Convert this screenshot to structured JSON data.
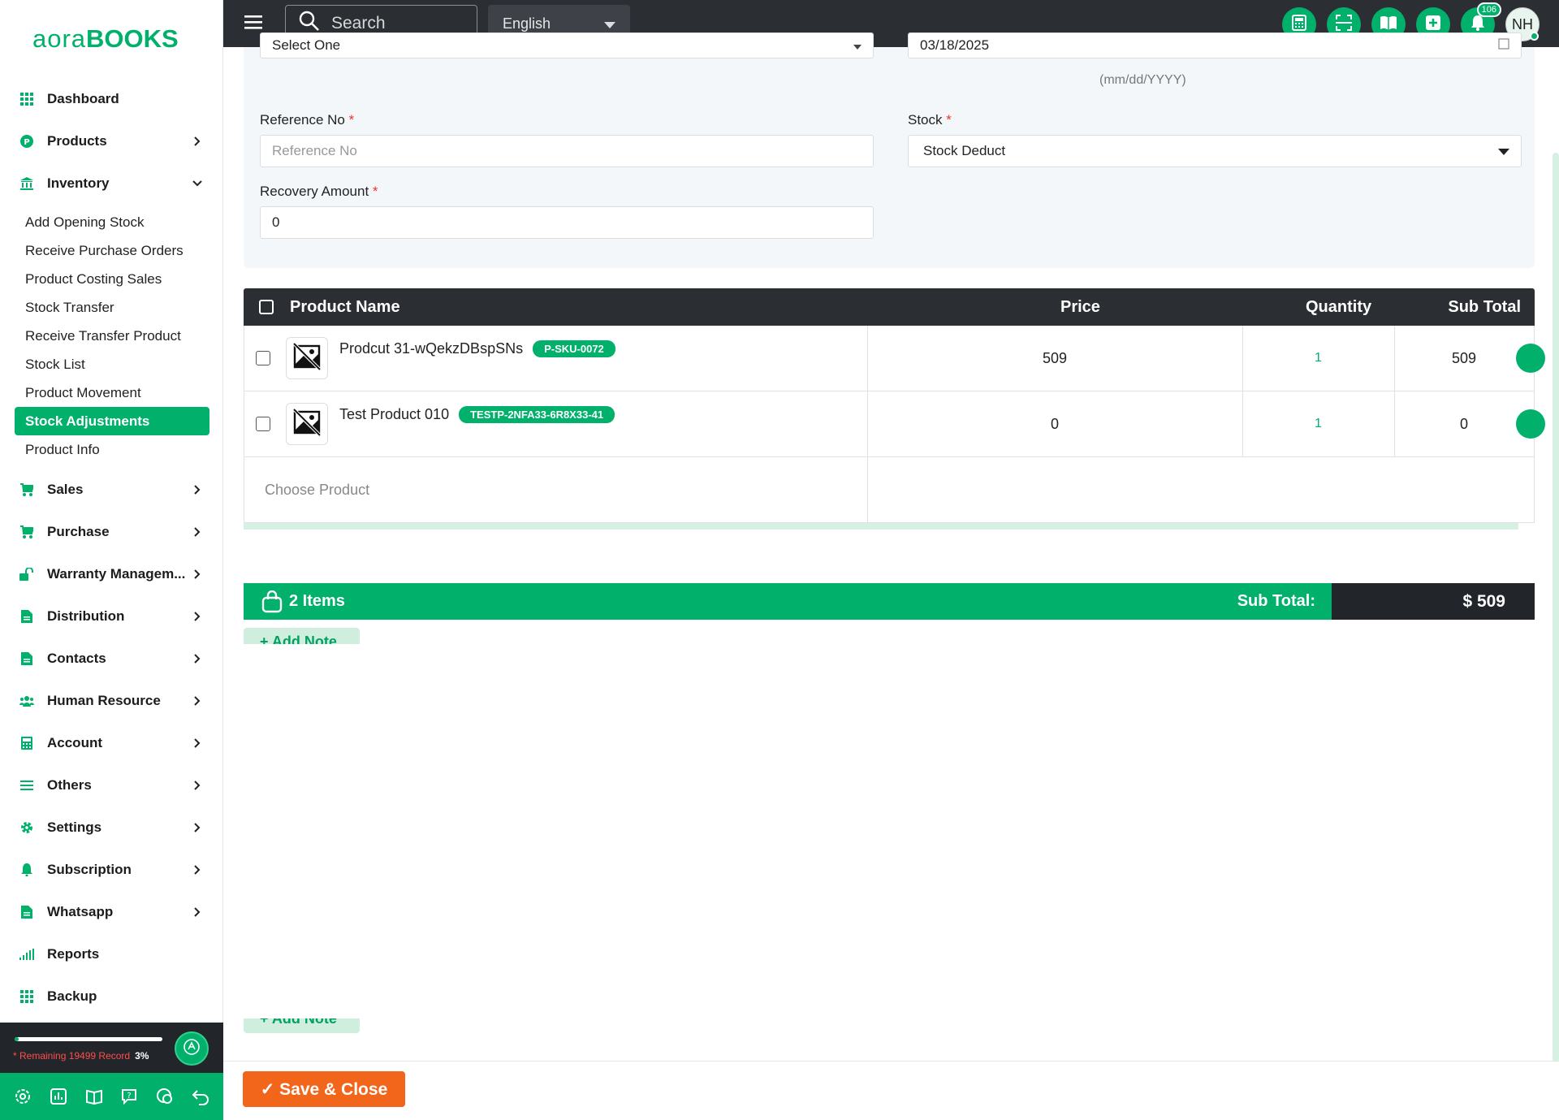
{
  "brand": {
    "logo_part1": "aora",
    "logo_part2": "BOOKS"
  },
  "sidebar": {
    "items": [
      {
        "label": "Dashboard",
        "icon": "grid-icon"
      },
      {
        "label": "Products",
        "icon": "product-icon"
      },
      {
        "label": "Inventory",
        "icon": "bank-icon"
      },
      {
        "label": "Sales",
        "icon": "cart-icon"
      },
      {
        "label": "Purchase",
        "icon": "cart-icon"
      },
      {
        "label": "Warranty Managem...",
        "icon": "unlock-icon"
      },
      {
        "label": "Distribution",
        "icon": "doc-icon"
      },
      {
        "label": "Contacts",
        "icon": "doc-icon"
      },
      {
        "label": "Human Resource",
        "icon": "users-icon"
      },
      {
        "label": "Account",
        "icon": "calculator-icon"
      },
      {
        "label": "Others",
        "icon": "menu-icon"
      },
      {
        "label": "Settings",
        "icon": "gear-icon"
      },
      {
        "label": "Subscription",
        "icon": "bell-icon"
      },
      {
        "label": "Whatsapp",
        "icon": "doc-icon"
      },
      {
        "label": "Reports",
        "icon": "bar-chart-icon"
      },
      {
        "label": "Backup",
        "icon": "grid-icon"
      }
    ],
    "inventory_sub": [
      "Add Opening Stock",
      "Receive Purchase Orders",
      "Product Costing Sales",
      "Stock Transfer",
      "Receive Transfer Product",
      "Stock List",
      "Product Movement",
      "Stock Adjustments",
      "Product Info"
    ],
    "record": {
      "text": "* Remaining 19499 Record",
      "percent": "3%",
      "progress_fraction": 0.03
    }
  },
  "topbar": {
    "search_placeholder": "Search",
    "language": "English",
    "notification_count": "106",
    "avatar_initials": "NH"
  },
  "form": {
    "select_value": "Select One",
    "date_value": "03/18/2025",
    "date_hint": "(mm/dd/YYYY)",
    "reference_label": "Reference No",
    "reference_placeholder": "Reference No",
    "stock_label": "Stock",
    "stock_value": "Stock Deduct",
    "recovery_label": "Recovery Amount",
    "recovery_value": "0",
    "required_mark": "*"
  },
  "table": {
    "headers": {
      "name": "Product Name",
      "price": "Price",
      "quantity": "Quantity",
      "subtotal": "Sub Total"
    },
    "rows": [
      {
        "name": "Prodcut 31-wQekzDBspSNs",
        "sku": "P-SKU-0072",
        "price": "509",
        "quantity": "1",
        "subtotal": "509"
      },
      {
        "name": "Test Product 010",
        "sku": "TESTP-2NFA33-6R8X33-41",
        "price": "0",
        "quantity": "1",
        "subtotal": "0"
      }
    ],
    "choose_placeholder": "Choose Product"
  },
  "summary": {
    "items": "2 Items",
    "subtotal_label": "Sub Total:",
    "subtotal_value": "$ 509"
  },
  "add_note": "+ Add Note",
  "save_button": "✓ Save & Close",
  "colors": {
    "accent": "#00b06b",
    "dark": "#2b2e33",
    "save": "#f2661c"
  }
}
